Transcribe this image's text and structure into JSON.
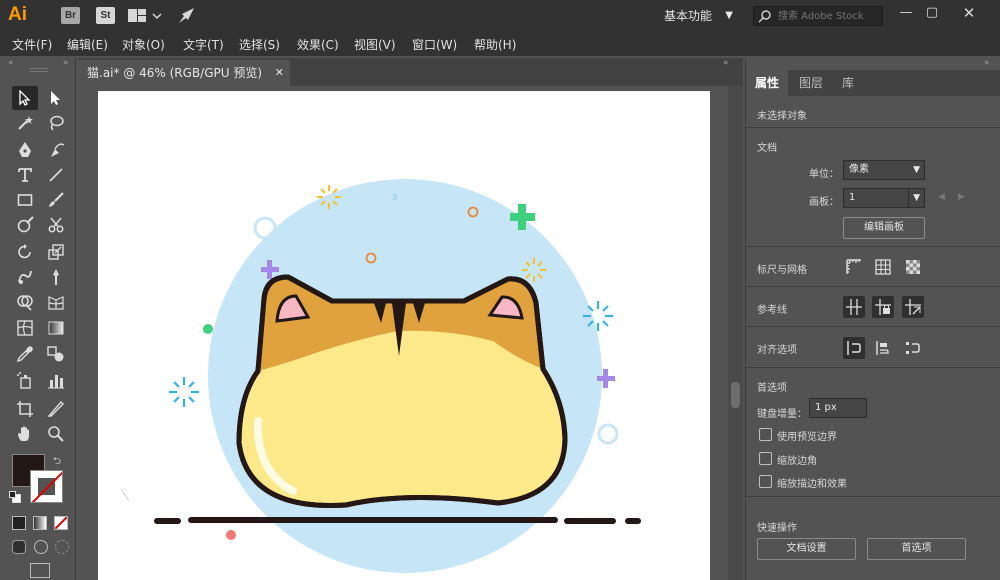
{
  "app": {
    "logo": "Ai",
    "bridge_label": "Br",
    "stock_label": "St",
    "workspace": "基本功能",
    "search_placeholder": "搜索 Adobe Stock",
    "accent": "#ff9a00"
  },
  "menu": [
    "文件(F)",
    "编辑(E)",
    "对象(O)",
    "文字(T)",
    "选择(S)",
    "效果(C)",
    "视图(V)",
    "窗口(W)",
    "帮助(H)"
  ],
  "document": {
    "tab_title": "猫.ai* @ 46% (RGB/GPU 预览)"
  },
  "panel": {
    "tabs": [
      "属性",
      "图层",
      "库"
    ],
    "active_tab": "属性",
    "no_selection": "未选择对象",
    "document_section": "文档",
    "unit_label": "单位：",
    "unit_value": "像素",
    "artboard_label": "画板：",
    "artboard_value": "1",
    "edit_artboard_button": "编辑画板",
    "rulers_section": "标尺与网格",
    "guides_section": "参考线",
    "align_section": "对齐选项",
    "prefs_section": "首选项",
    "keyboard_increment_label": "键盘增量：",
    "keyboard_increment_value": "1 px",
    "checkboxes": [
      "使用预览边界",
      "缩放边角",
      "缩放描边和效果"
    ],
    "quick_actions_section": "快速操作",
    "doc_setup_button": "文档设置",
    "prefs_button": "首选项"
  },
  "colors": {
    "fill": "#231815",
    "stroke": "#ffffff",
    "circle_bg": "#c6e6f8",
    "cat_ears": "#e0a23c",
    "cat_face": "#fde98a"
  }
}
